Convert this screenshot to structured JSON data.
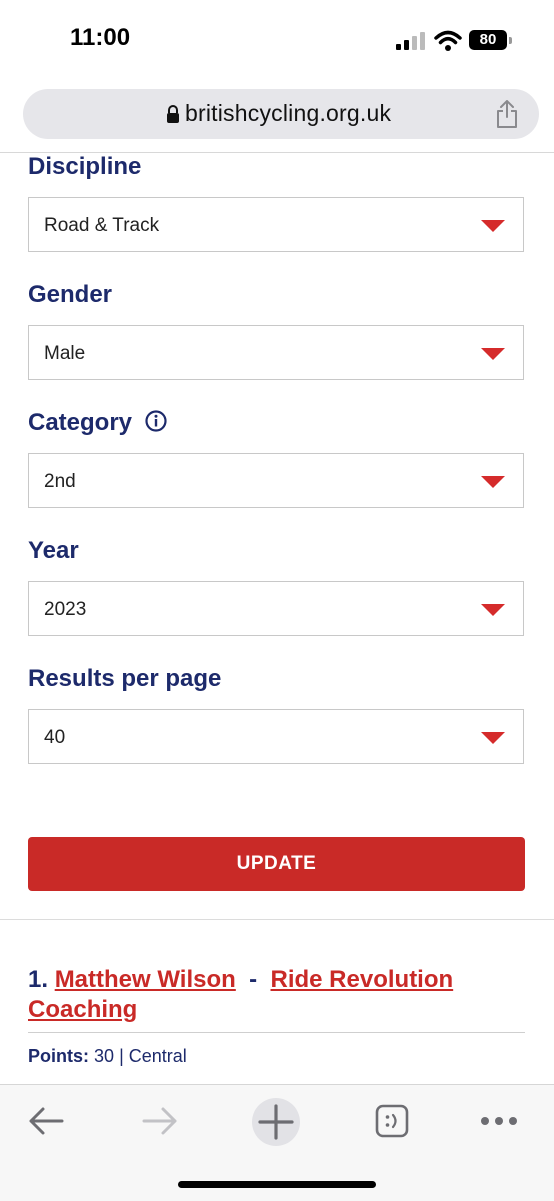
{
  "status": {
    "time": "11:00",
    "battery": "80"
  },
  "browser": {
    "url": "britishcycling.org.uk"
  },
  "form": {
    "fields": [
      {
        "label": "Discipline",
        "value": "Road & Track"
      },
      {
        "label": "Gender",
        "value": "Male"
      },
      {
        "label": "Category",
        "value": "2nd"
      },
      {
        "label": "Year",
        "value": "2023"
      },
      {
        "label": "Results per page",
        "value": "40"
      }
    ],
    "update_label": "UPDATE"
  },
  "results": [
    {
      "rank": "1.",
      "name": "Matthew Wilson",
      "separator": "-",
      "club": "Ride Revolution Coaching",
      "points_label": "Points:",
      "points": "30",
      "region_sep": "|",
      "region": "Central"
    }
  ],
  "colors": {
    "navy": "#1d2a6b",
    "red": "#c92a27"
  }
}
